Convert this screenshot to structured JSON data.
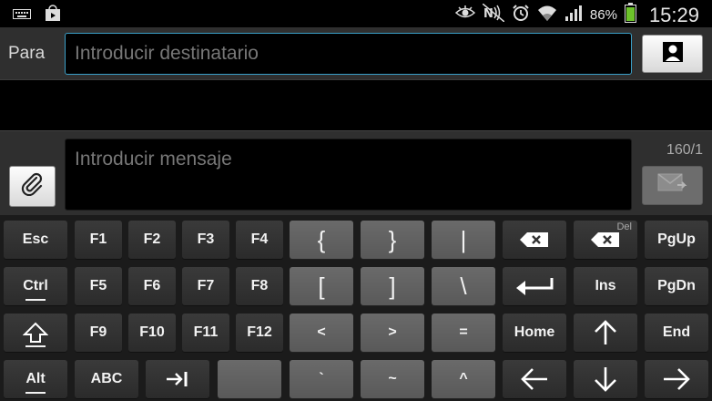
{
  "status_bar": {
    "battery_percent": "86%",
    "time": "15:29",
    "icons": [
      "keyboard-icon",
      "play-store-icon",
      "eye-icon",
      "nfc-icon",
      "alarm-icon",
      "wifi-icon",
      "signal-icon",
      "battery-icon"
    ]
  },
  "recipient": {
    "label": "Para",
    "placeholder": "Introducir destinatario"
  },
  "compose": {
    "placeholder": "Introducir mensaje",
    "counter": "160/1"
  },
  "keyboard": {
    "rows": [
      [
        {
          "label": "Esc",
          "style": "dark"
        },
        {
          "label": "F1",
          "style": "dark"
        },
        {
          "label": "F2",
          "style": "dark"
        },
        {
          "label": "F3",
          "style": "dark"
        },
        {
          "label": "F4",
          "style": "dark"
        },
        {
          "label": "{",
          "style": "light",
          "big": true
        },
        {
          "label": "}",
          "style": "light",
          "big": true
        },
        {
          "label": "|",
          "style": "light",
          "big": true
        },
        {
          "label": "",
          "style": "dark",
          "icon": "backspace-icon"
        },
        {
          "label": "",
          "sub": "Del",
          "style": "dark",
          "icon": "delete-icon"
        },
        {
          "label": "PgUp",
          "style": "dark"
        }
      ],
      [
        {
          "label": "Ctrl",
          "style": "dark",
          "underbar": true
        },
        {
          "label": "F5",
          "style": "dark"
        },
        {
          "label": "F6",
          "style": "dark"
        },
        {
          "label": "F7",
          "style": "dark"
        },
        {
          "label": "F8",
          "style": "dark"
        },
        {
          "label": "[",
          "style": "light",
          "big": true
        },
        {
          "label": "]",
          "style": "light",
          "big": true
        },
        {
          "label": "\\",
          "style": "light",
          "big": true
        },
        {
          "label": "",
          "style": "dark",
          "icon": "enter-icon"
        },
        {
          "label": "Ins",
          "style": "dark"
        },
        {
          "label": "PgDn",
          "style": "dark"
        }
      ],
      [
        {
          "label": "",
          "style": "dark",
          "icon": "shift-icon",
          "underbar": true
        },
        {
          "label": "F9",
          "style": "dark"
        },
        {
          "label": "F10",
          "style": "dark"
        },
        {
          "label": "F11",
          "style": "dark"
        },
        {
          "label": "F12",
          "style": "dark"
        },
        {
          "label": "<",
          "style": "light"
        },
        {
          "label": ">",
          "style": "light"
        },
        {
          "label": "=",
          "style": "light"
        },
        {
          "label": "Home",
          "style": "dark"
        },
        {
          "label": "",
          "style": "dark",
          "icon": "arrow-up-icon"
        },
        {
          "label": "End",
          "style": "dark"
        }
      ],
      [
        {
          "label": "Alt",
          "style": "dark",
          "underbar": true
        },
        {
          "label": "ABC",
          "style": "dark"
        },
        {
          "label": "",
          "style": "dark",
          "icon": "tab-icon"
        },
        {
          "label": "",
          "style": "light",
          "icon": "space-key"
        },
        {
          "label": "`",
          "style": "light"
        },
        {
          "label": "~",
          "style": "light"
        },
        {
          "label": "^",
          "style": "light"
        },
        {
          "label": "",
          "style": "dark",
          "icon": "arrow-left-icon"
        },
        {
          "label": "",
          "style": "dark",
          "icon": "arrow-down-icon"
        },
        {
          "label": "",
          "style": "dark",
          "icon": "arrow-right-icon"
        }
      ]
    ]
  }
}
